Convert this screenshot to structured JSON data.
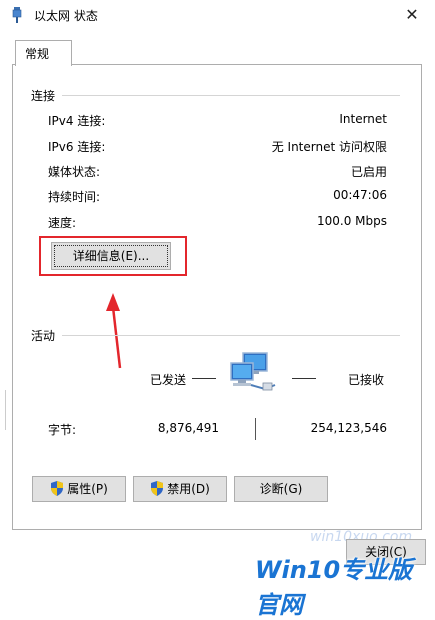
{
  "window": {
    "title": "以太网 状态",
    "close_glyph": "✕"
  },
  "tabs": [
    {
      "label": "常规"
    }
  ],
  "connection": {
    "section_label": "连接",
    "rows": [
      {
        "label": "IPv4 连接:",
        "value": "Internet"
      },
      {
        "label": "IPv6 连接:",
        "value": "无 Internet 访问权限"
      },
      {
        "label": "媒体状态:",
        "value": "已启用"
      },
      {
        "label": "持续时间:",
        "value": "00:47:06"
      },
      {
        "label": "速度:",
        "value": "100.0 Mbps"
      }
    ],
    "details_button": "详细信息(E)..."
  },
  "activity": {
    "section_label": "活动",
    "sent_label": "已发送",
    "received_label": "已接收",
    "bytes_label": "字节:",
    "bytes_sent": "8,876,491",
    "bytes_received": "254,123,546"
  },
  "buttons": {
    "properties": "属性(P)",
    "disable": "禁用(D)",
    "diagnose": "诊断(G)",
    "close": "关闭(C)"
  },
  "watermark": {
    "main": "Win10专业版官网",
    "url": "win10xuo.com"
  },
  "colors": {
    "annotation_red": "#e3262c",
    "watermark_blue": "#1a74d3"
  },
  "icons": [
    "ethernet-icon",
    "close-icon",
    "network-computers-icon",
    "shield-icon"
  ]
}
